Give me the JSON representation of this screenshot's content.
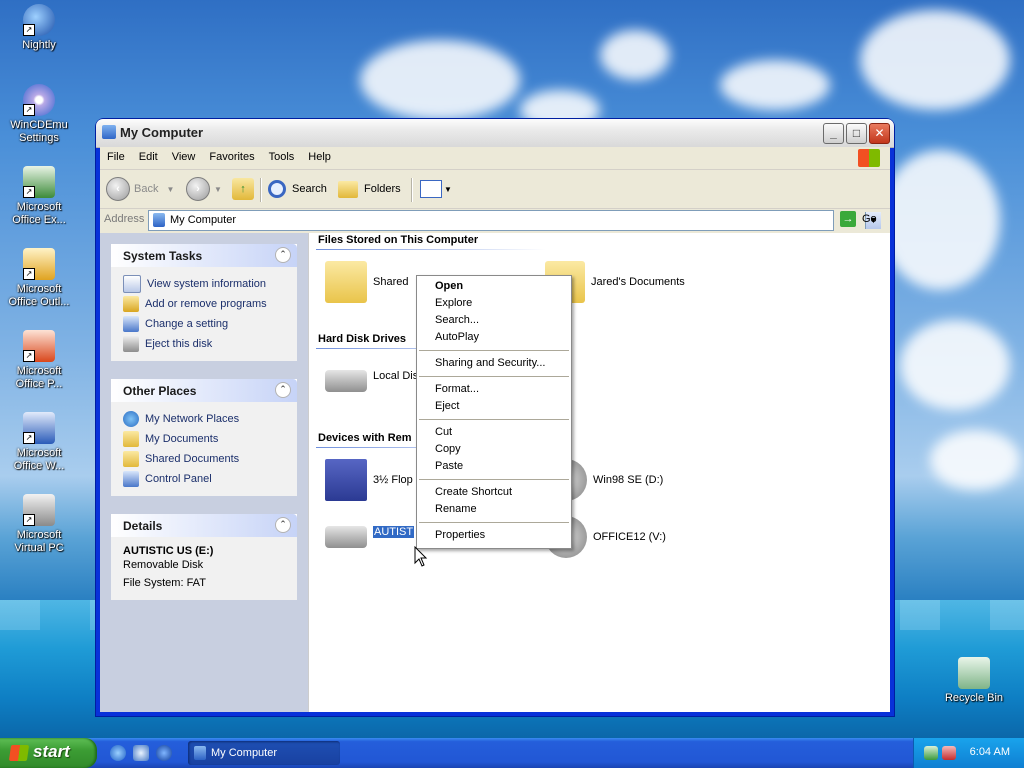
{
  "desktop": {
    "icons": [
      {
        "label": "Nightly"
      },
      {
        "label": "WinCDEmu Settings"
      },
      {
        "label": "Microsoft Office Ex..."
      },
      {
        "label": "Microsoft Office Outl..."
      },
      {
        "label": "Microsoft Office P..."
      },
      {
        "label": "Microsoft Office W..."
      },
      {
        "label": "Microsoft Virtual PC"
      }
    ],
    "recycle_bin": "Recycle Bin"
  },
  "window": {
    "title": "My Computer",
    "menu": [
      "File",
      "Edit",
      "View",
      "Favorites",
      "Tools",
      "Help"
    ],
    "toolbar": {
      "back": "Back",
      "search": "Search",
      "folders": "Folders"
    },
    "address": {
      "label": "Address",
      "value": "My Computer",
      "go": "Go"
    }
  },
  "left_pane": {
    "system_tasks": {
      "title": "System Tasks",
      "items": [
        "View system information",
        "Add or remove programs",
        "Change a setting",
        "Eject this disk"
      ]
    },
    "other_places": {
      "title": "Other Places",
      "items": [
        "My Network Places",
        "My Documents",
        "Shared Documents",
        "Control Panel"
      ]
    },
    "details": {
      "title": "Details",
      "name": "AUTISTIC US (E:)",
      "type": "Removable Disk",
      "filesystem": "File System: FAT"
    }
  },
  "content": {
    "groups": {
      "files": "Files Stored on This Computer",
      "hard": "Hard Disk Drives",
      "devices": "Devices with Rem"
    },
    "items": {
      "shared": "Shared",
      "jared": "Jared's Documents",
      "local": "Local Dis",
      "floppy": "3½ Flop",
      "win98": "Win98 SE (D:)",
      "autistic": "AUTIST",
      "office12": "OFFICE12 (V:)"
    }
  },
  "context_menu": {
    "items": [
      "Open",
      "Explore",
      "Search...",
      "AutoPlay",
      "Sharing and Security...",
      "Format...",
      "Eject",
      "Cut",
      "Copy",
      "Paste",
      "Create Shortcut",
      "Rename",
      "Properties"
    ]
  },
  "taskbar": {
    "start": "start",
    "task": "My Computer",
    "clock": "6:04 AM"
  }
}
